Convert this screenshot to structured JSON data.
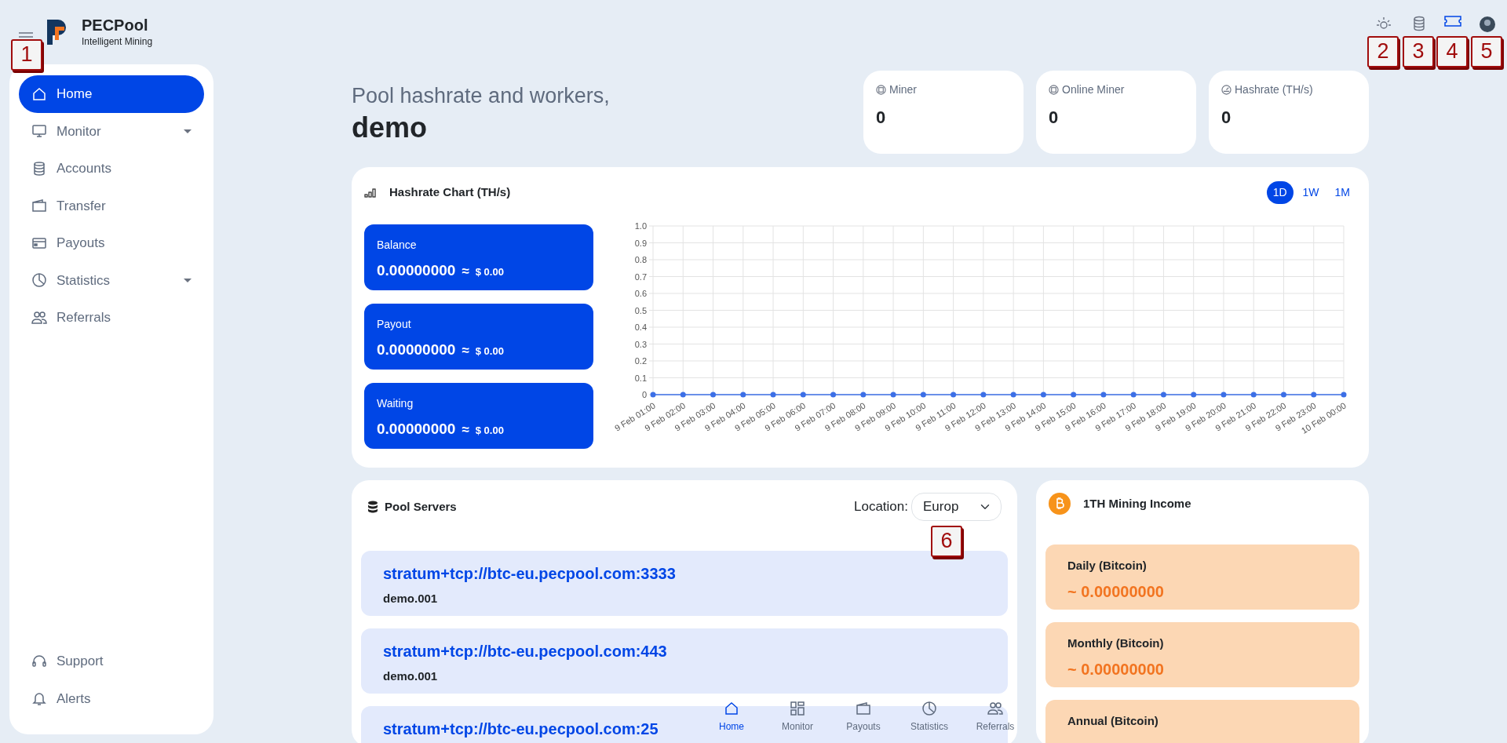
{
  "header": {
    "menu_marker": "1",
    "brand": "PECPool",
    "tagline": "Intelligent Mining",
    "top_icons": [
      {
        "marker": "2"
      },
      {
        "marker": "3"
      },
      {
        "marker": "4"
      },
      {
        "marker": "5"
      }
    ]
  },
  "sidebar": {
    "items": [
      {
        "label": "Home",
        "selected": true,
        "submenu": false
      },
      {
        "label": "Monitor",
        "selected": false,
        "submenu": true
      },
      {
        "label": "Accounts",
        "selected": false,
        "submenu": false
      },
      {
        "label": "Transfer",
        "selected": false,
        "submenu": false
      },
      {
        "label": "Payouts",
        "selected": false,
        "submenu": false
      },
      {
        "label": "Statistics",
        "selected": false,
        "submenu": true
      },
      {
        "label": "Referrals",
        "selected": false,
        "submenu": false
      }
    ],
    "footer_items": [
      {
        "label": "Support"
      },
      {
        "label": "Alerts"
      }
    ]
  },
  "greeting": {
    "line": "Pool hashrate and workers,",
    "user": "demo"
  },
  "stats": [
    {
      "label": "Miner",
      "value": "0"
    },
    {
      "label": "Online Miner",
      "value": "0"
    },
    {
      "label": "Hashrate (TH/s)",
      "value": "0"
    }
  ],
  "hashrate_chart": {
    "title": "Hashrate Chart (TH/s)",
    "periods": [
      {
        "label": "1D",
        "selected": true
      },
      {
        "label": "1W",
        "selected": false
      },
      {
        "label": "1M",
        "selected": false
      }
    ],
    "balances": [
      {
        "label": "Balance",
        "amount": "0.00000000",
        "approx": "≈",
        "usd": "$ 0.00"
      },
      {
        "label": "Payout",
        "amount": "0.00000000",
        "approx": "≈",
        "usd": "$ 0.00"
      },
      {
        "label": "Waiting",
        "amount": "0.00000000",
        "approx": "≈",
        "usd": "$ 0.00"
      }
    ],
    "chart_data": {
      "type": "line",
      "categories": [
        "9 Feb 01:00",
        "9 Feb 02:00",
        "9 Feb 03:00",
        "9 Feb 04:00",
        "9 Feb 05:00",
        "9 Feb 06:00",
        "9 Feb 07:00",
        "9 Feb 08:00",
        "9 Feb 09:00",
        "9 Feb 10:00",
        "9 Feb 11:00",
        "9 Feb 12:00",
        "9 Feb 13:00",
        "9 Feb 14:00",
        "9 Feb 15:00",
        "9 Feb 16:00",
        "9 Feb 17:00",
        "9 Feb 18:00",
        "9 Feb 19:00",
        "9 Feb 20:00",
        "9 Feb 21:00",
        "9 Feb 22:00",
        "9 Feb 23:00",
        "10 Feb 00:00"
      ],
      "grid": true,
      "series": [
        {
          "color": "#3c6fe6",
          "marker": true,
          "values": [
            0,
            0,
            0,
            0,
            0,
            0,
            0,
            0,
            0,
            0,
            0,
            0,
            0,
            0,
            0,
            0,
            0,
            0,
            0,
            0,
            0,
            0,
            0,
            0
          ]
        }
      ],
      "ylim": [
        0,
        1
      ],
      "yticks": [
        0,
        {
          "value": 0.1,
          "label": "0.1"
        },
        {
          "value": 0.2,
          "label": "0.2"
        },
        {
          "value": 0.3,
          "label": "0.3"
        },
        {
          "value": 0.4,
          "label": "0.4"
        },
        {
          "value": 0.5,
          "label": "0.5"
        },
        {
          "value": 0.6,
          "label": "0.6"
        },
        {
          "value": 0.7,
          "label": "0.7"
        },
        {
          "value": 0.8,
          "label": "0.8"
        },
        {
          "value": 0.9,
          "label": "0.9"
        },
        {
          "value": 1,
          "label": "1.0"
        }
      ]
    }
  },
  "pool_servers": {
    "title": "Pool Servers",
    "location_label": "Location:",
    "location": "Europ",
    "location_marker": "6",
    "servers": [
      {
        "url": "stratum+tcp://btc-eu.pecpool.com:3333",
        "worker": "demo.001"
      },
      {
        "url": "stratum+tcp://btc-eu.pecpool.com:443",
        "worker": "demo.001"
      },
      {
        "url": "stratum+tcp://btc-eu.pecpool.com:25"
      }
    ]
  },
  "income": {
    "title": "1TH Mining Income",
    "rows": [
      {
        "label": "Daily (Bitcoin)",
        "value": "~ 0.00000000"
      },
      {
        "label": "Monthly (Bitcoin)",
        "value": "~ 0.00000000"
      },
      {
        "label": "Annual (Bitcoin)"
      }
    ]
  },
  "bottom_nav": [
    {
      "label": "Home",
      "selected": true
    },
    {
      "label": "Monitor",
      "selected": false
    },
    {
      "label": "Payouts",
      "selected": false
    },
    {
      "label": "Statistics",
      "selected": false
    },
    {
      "label": "Referrals",
      "selected": false
    }
  ]
}
